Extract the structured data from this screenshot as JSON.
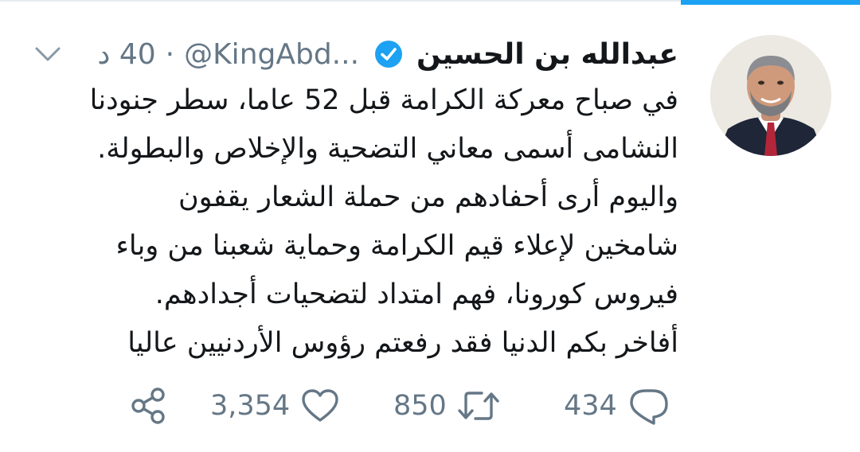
{
  "tweet": {
    "author_name": "عبدالله بن الحسين",
    "handle": "@KingAbd...",
    "time": "40 د",
    "separator": "·",
    "verified": true,
    "text_lines": [
      "في صباح معركة الكرامة قبل 52 عاما، سطر جنودنا",
      "النشامى أسمى معاني التضحية والإخلاص والبطولة.",
      "واليوم أرى أحفادهم من حملة الشعار يقفون",
      "شامخين لإعلاء قيم الكرامة وحماية شعبنا من وباء",
      "فيروس كورونا، فهم امتداد لتضحيات أجدادهم.",
      "أفاخر بكم الدنيا فقد رفعتم رؤوس الأردنيين عاليا"
    ]
  },
  "actions": {
    "reply_count": "434",
    "retweet_count": "850",
    "like_count": "3,354"
  },
  "icons": {
    "reply": "reply-icon",
    "retweet": "retweet-icon",
    "like": "heart-icon",
    "share": "share-icon",
    "more": "chevron-down-icon",
    "verified": "verified-badge-icon"
  },
  "colors": {
    "accent": "#1da1f2",
    "text": "#14171a",
    "muted": "#657786"
  }
}
